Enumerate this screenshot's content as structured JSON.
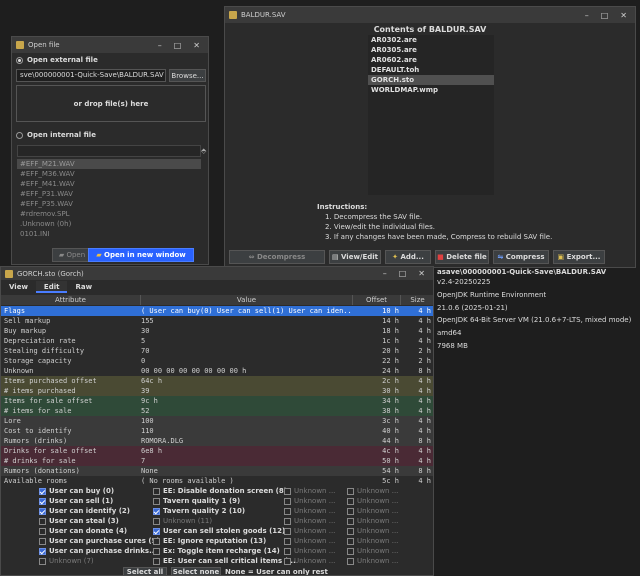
{
  "open_window": {
    "title": "Open file",
    "external_label": "Open external file",
    "path_value": "sve\\000000001-Quick-Save\\BALDUR.SAV",
    "browse_label": "Browse...",
    "drop_label": "or drop file(s) here",
    "internal_label": "Open internal file",
    "internal_items": [
      "#EFF_M21.WAV",
      "#EFF_M36.WAV",
      "#EFF_M41.WAV",
      "#EFF_P31.WAV",
      "#EFF_P35.WAV",
      "#rdremov.SPL",
      ".Unknown (0h)",
      "0101.INI"
    ],
    "open_label": "Open",
    "open_new_label": "Open in new window"
  },
  "sav_window": {
    "title": "BALDUR.SAV",
    "contents_title": "Contents of BALDUR.SAV",
    "files": [
      "AR0302.are",
      "AR0305.are",
      "AR0602.are",
      "DEFAULT.toh",
      "GORCH.sto",
      "WORLDMAP.wmp"
    ],
    "selected_index": 4,
    "instructions_heading": "Instructions:",
    "instructions": [
      "1. Decompress the SAV file.",
      "2. View/edit the individual files.",
      "3. If any changes have been made, Compress to rebuild SAV file."
    ],
    "buttons": {
      "decompress": "Decompress",
      "view_edit": "View/Edit",
      "add": "Add...",
      "delete": "Delete file",
      "compress": "Compress",
      "export": "Export..."
    }
  },
  "background_info": {
    "path": "asave\\000000001-Quick-Save\\BALDUR.SAV",
    "version": "v2.4-20250225",
    "jre": "OpenJDK Runtime Environment",
    "java_version": "21.0.6 (2025-01-21)",
    "vm": "OpenJDK 64-Bit Server VM (21.0.6+7-LTS, mixed mode)",
    "arch": "amd64",
    "memory": "7968 MB"
  },
  "gorch_window": {
    "title": "GORCH.sto (Gorch)",
    "menu": [
      "View",
      "Edit",
      "Raw"
    ],
    "active_menu": 1,
    "columns": [
      "Attribute",
      "Value",
      "Offset",
      "Size"
    ],
    "rows": [
      {
        "attr": "Flags",
        "value": "( User can buy(0) User can sell(1) User can iden..",
        "offset": "10 h",
        "size": "4 h",
        "bg": "#2f6fd6"
      },
      {
        "attr": "Sell markup",
        "value": "155",
        "offset": "14 h",
        "size": "4 h",
        "bg": "#2b2b2b"
      },
      {
        "attr": "Buy markup",
        "value": "30",
        "offset": "18 h",
        "size": "4 h",
        "bg": "#2b2b2b"
      },
      {
        "attr": "Depreciation rate",
        "value": "5",
        "offset": "1c h",
        "size": "4 h",
        "bg": "#2b2b2b"
      },
      {
        "attr": "Stealing difficulty",
        "value": "70",
        "offset": "20 h",
        "size": "2 h",
        "bg": "#2b2b2b"
      },
      {
        "attr": "Storage capacity",
        "value": "0",
        "offset": "22 h",
        "size": "2 h",
        "bg": "#2b2b2b"
      },
      {
        "attr": "Unknown",
        "value": "00 00 00 00 00 00 00 00 h",
        "offset": "24 h",
        "size": "8 h",
        "bg": "#2b2b2b"
      },
      {
        "attr": "Items purchased offset",
        "value": "64c h",
        "offset": "2c h",
        "size": "4 h",
        "bg": "#4a4a33"
      },
      {
        "attr": "# items purchased",
        "value": "39",
        "offset": "30 h",
        "size": "4 h",
        "bg": "#4a4a33"
      },
      {
        "attr": "Items for sale offset",
        "value": "9c h",
        "offset": "34 h",
        "size": "4 h",
        "bg": "#2f4a38"
      },
      {
        "attr": "# items for sale",
        "value": "52",
        "offset": "38 h",
        "size": "4 h",
        "bg": "#2f4a38"
      },
      {
        "attr": "Lore",
        "value": "100",
        "offset": "3c h",
        "size": "4 h",
        "bg": "#3a3a3a"
      },
      {
        "attr": "Cost to identify",
        "value": "110",
        "offset": "40 h",
        "size": "4 h",
        "bg": "#3a3a3a"
      },
      {
        "attr": "Rumors (drinks)",
        "value": "ROMORA.DLG",
        "offset": "44 h",
        "size": "8 h",
        "bg": "#3a3a3a"
      },
      {
        "attr": "Drinks for sale offset",
        "value": "6e8 h",
        "offset": "4c h",
        "size": "4 h",
        "bg": "#4a2a35"
      },
      {
        "attr": "# drinks for sale",
        "value": "7",
        "offset": "50 h",
        "size": "4 h",
        "bg": "#4a2a35"
      },
      {
        "attr": "Rumors (donations)",
        "value": "None",
        "offset": "54 h",
        "size": "8 h",
        "bg": "#3a3a3a"
      },
      {
        "attr": "Available rooms",
        "value": "( No rooms available )",
        "offset": "5c h",
        "size": "4 h",
        "bg": "#2b2b2b"
      }
    ],
    "flags": [
      {
        "label": "User can buy (0)",
        "checked": true,
        "dim": false
      },
      {
        "label": "User can sell (1)",
        "checked": true,
        "dim": false
      },
      {
        "label": "User can identify (2)",
        "checked": true,
        "dim": false
      },
      {
        "label": "User can steal (3)",
        "checked": false,
        "dim": false
      },
      {
        "label": "User can donate (4)",
        "checked": false,
        "dim": false
      },
      {
        "label": "User can purchase cures (5)",
        "checked": false,
        "dim": false
      },
      {
        "label": "User can purchase drinks...",
        "checked": true,
        "dim": false
      },
      {
        "label": "Unknown (7)",
        "checked": false,
        "dim": true
      },
      {
        "label": "EE: Disable donation screen (8)",
        "checked": false,
        "dim": false
      },
      {
        "label": "Tavern quality 1 (9)",
        "checked": false,
        "dim": false
      },
      {
        "label": "Tavern quality 2 (10)",
        "checked": true,
        "dim": false
      },
      {
        "label": "Unknown (11)",
        "checked": false,
        "dim": true
      },
      {
        "label": "User can sell stolen goods (12)",
        "checked": true,
        "dim": false
      },
      {
        "label": "EE: Ignore reputation (13)",
        "checked": false,
        "dim": false
      },
      {
        "label": "Ex: Toggle item recharge (14)",
        "checked": false,
        "dim": false
      },
      {
        "label": "EE: User can sell critical items (...",
        "checked": false,
        "dim": false
      },
      {
        "label": "Unknown ...",
        "checked": false,
        "dim": true
      },
      {
        "label": "Unknown ...",
        "checked": false,
        "dim": true
      },
      {
        "label": "Unknown ...",
        "checked": false,
        "dim": true
      },
      {
        "label": "Unknown ...",
        "checked": false,
        "dim": true
      },
      {
        "label": "Unknown ...",
        "checked": false,
        "dim": true
      },
      {
        "label": "Unknown ...",
        "checked": false,
        "dim": true
      },
      {
        "label": "Unknown ...",
        "checked": false,
        "dim": true
      },
      {
        "label": "Unknown ...",
        "checked": false,
        "dim": true
      },
      {
        "label": "Unknown ...",
        "checked": false,
        "dim": true
      },
      {
        "label": "Unknown ...",
        "checked": false,
        "dim": true
      },
      {
        "label": "Unknown ...",
        "checked": false,
        "dim": true
      },
      {
        "label": "Unknown ...",
        "checked": false,
        "dim": true
      },
      {
        "label": "Unknown ...",
        "checked": false,
        "dim": true
      },
      {
        "label": "Unknown ...",
        "checked": false,
        "dim": true
      },
      {
        "label": "Unknown ...",
        "checked": false,
        "dim": true
      },
      {
        "label": "Unknown ...",
        "checked": false,
        "dim": true
      }
    ],
    "select_all": "Select all",
    "select_none": "Select none",
    "none_note": "None = User can only rest"
  }
}
